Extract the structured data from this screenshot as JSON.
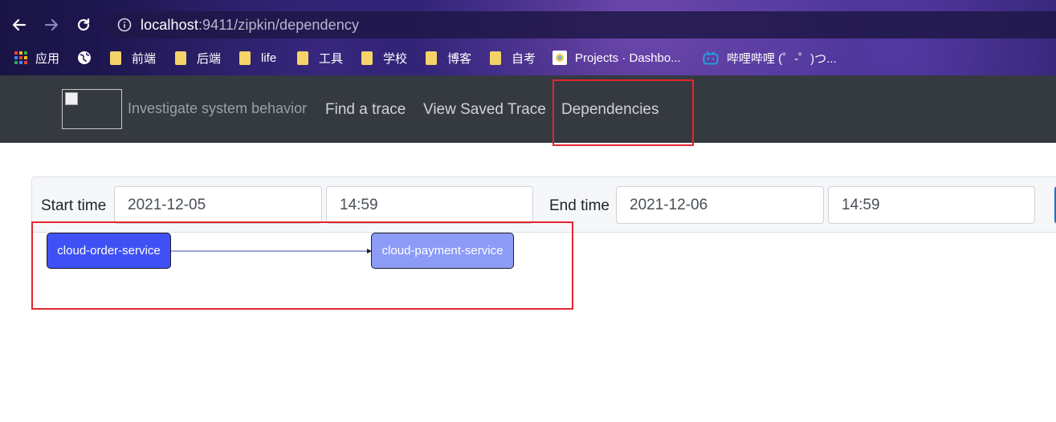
{
  "browser": {
    "url_host": "localhost",
    "url_rest": ":9411/zipkin/dependency",
    "bookmarks": [
      {
        "label": "应用",
        "icon": "apps-grid-icon"
      },
      {
        "label": "",
        "icon": "globe-icon"
      },
      {
        "label": "前端",
        "icon": "folder-icon"
      },
      {
        "label": "后端",
        "icon": "folder-icon"
      },
      {
        "label": "life",
        "icon": "folder-icon"
      },
      {
        "label": "工具",
        "icon": "folder-icon"
      },
      {
        "label": "学校",
        "icon": "folder-icon"
      },
      {
        "label": "博客",
        "icon": "folder-icon"
      },
      {
        "label": "自考",
        "icon": "folder-icon"
      },
      {
        "label": "Projects · Dashbo...",
        "icon": "gitlab-icon"
      },
      {
        "label": "哔哩哔哩 (゜-゜)つ...",
        "icon": "bilibili-icon"
      }
    ]
  },
  "navbar": {
    "tagline": "Investigate system behavior",
    "links": [
      "Find a trace",
      "View Saved Trace",
      "Dependencies"
    ]
  },
  "filter": {
    "start_label": "Start time",
    "start_date": "2021-12-05",
    "start_time": "14:59",
    "end_label": "End time",
    "end_date": "2021-12-06",
    "end_time": "14:59"
  },
  "graph": {
    "nodes": [
      {
        "name": "cloud-order-service",
        "color": "#3f51f5"
      },
      {
        "name": "cloud-payment-service",
        "color": "#8c9cf7"
      }
    ],
    "edges": [
      {
        "from": "cloud-order-service",
        "to": "cloud-payment-service"
      }
    ]
  },
  "colors": {
    "highlight": "#e3262f",
    "navbar": "#343a40",
    "edge": "#3b47b8"
  }
}
